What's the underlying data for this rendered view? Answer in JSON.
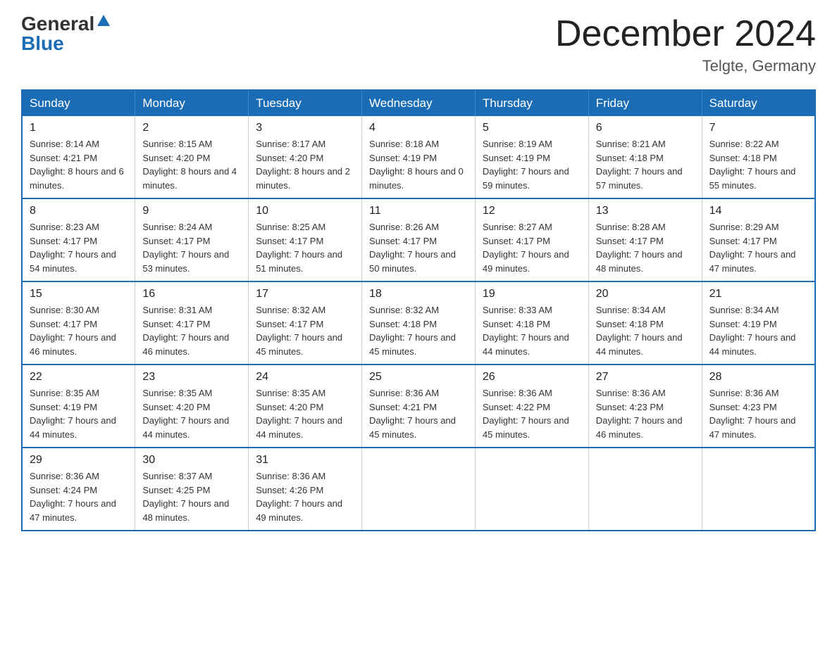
{
  "header": {
    "logo_general": "General",
    "logo_blue": "Blue",
    "month_title": "December 2024",
    "location": "Telgte, Germany"
  },
  "weekdays": [
    "Sunday",
    "Monday",
    "Tuesday",
    "Wednesday",
    "Thursday",
    "Friday",
    "Saturday"
  ],
  "weeks": [
    [
      {
        "day": "1",
        "sunrise": "8:14 AM",
        "sunset": "4:21 PM",
        "daylight": "8 hours and 6 minutes."
      },
      {
        "day": "2",
        "sunrise": "8:15 AM",
        "sunset": "4:20 PM",
        "daylight": "8 hours and 4 minutes."
      },
      {
        "day": "3",
        "sunrise": "8:17 AM",
        "sunset": "4:20 PM",
        "daylight": "8 hours and 2 minutes."
      },
      {
        "day": "4",
        "sunrise": "8:18 AM",
        "sunset": "4:19 PM",
        "daylight": "8 hours and 0 minutes."
      },
      {
        "day": "5",
        "sunrise": "8:19 AM",
        "sunset": "4:19 PM",
        "daylight": "7 hours and 59 minutes."
      },
      {
        "day": "6",
        "sunrise": "8:21 AM",
        "sunset": "4:18 PM",
        "daylight": "7 hours and 57 minutes."
      },
      {
        "day": "7",
        "sunrise": "8:22 AM",
        "sunset": "4:18 PM",
        "daylight": "7 hours and 55 minutes."
      }
    ],
    [
      {
        "day": "8",
        "sunrise": "8:23 AM",
        "sunset": "4:17 PM",
        "daylight": "7 hours and 54 minutes."
      },
      {
        "day": "9",
        "sunrise": "8:24 AM",
        "sunset": "4:17 PM",
        "daylight": "7 hours and 53 minutes."
      },
      {
        "day": "10",
        "sunrise": "8:25 AM",
        "sunset": "4:17 PM",
        "daylight": "7 hours and 51 minutes."
      },
      {
        "day": "11",
        "sunrise": "8:26 AM",
        "sunset": "4:17 PM",
        "daylight": "7 hours and 50 minutes."
      },
      {
        "day": "12",
        "sunrise": "8:27 AM",
        "sunset": "4:17 PM",
        "daylight": "7 hours and 49 minutes."
      },
      {
        "day": "13",
        "sunrise": "8:28 AM",
        "sunset": "4:17 PM",
        "daylight": "7 hours and 48 minutes."
      },
      {
        "day": "14",
        "sunrise": "8:29 AM",
        "sunset": "4:17 PM",
        "daylight": "7 hours and 47 minutes."
      }
    ],
    [
      {
        "day": "15",
        "sunrise": "8:30 AM",
        "sunset": "4:17 PM",
        "daylight": "7 hours and 46 minutes."
      },
      {
        "day": "16",
        "sunrise": "8:31 AM",
        "sunset": "4:17 PM",
        "daylight": "7 hours and 46 minutes."
      },
      {
        "day": "17",
        "sunrise": "8:32 AM",
        "sunset": "4:17 PM",
        "daylight": "7 hours and 45 minutes."
      },
      {
        "day": "18",
        "sunrise": "8:32 AM",
        "sunset": "4:18 PM",
        "daylight": "7 hours and 45 minutes."
      },
      {
        "day": "19",
        "sunrise": "8:33 AM",
        "sunset": "4:18 PM",
        "daylight": "7 hours and 44 minutes."
      },
      {
        "day": "20",
        "sunrise": "8:34 AM",
        "sunset": "4:18 PM",
        "daylight": "7 hours and 44 minutes."
      },
      {
        "day": "21",
        "sunrise": "8:34 AM",
        "sunset": "4:19 PM",
        "daylight": "7 hours and 44 minutes."
      }
    ],
    [
      {
        "day": "22",
        "sunrise": "8:35 AM",
        "sunset": "4:19 PM",
        "daylight": "7 hours and 44 minutes."
      },
      {
        "day": "23",
        "sunrise": "8:35 AM",
        "sunset": "4:20 PM",
        "daylight": "7 hours and 44 minutes."
      },
      {
        "day": "24",
        "sunrise": "8:35 AM",
        "sunset": "4:20 PM",
        "daylight": "7 hours and 44 minutes."
      },
      {
        "day": "25",
        "sunrise": "8:36 AM",
        "sunset": "4:21 PM",
        "daylight": "7 hours and 45 minutes."
      },
      {
        "day": "26",
        "sunrise": "8:36 AM",
        "sunset": "4:22 PM",
        "daylight": "7 hours and 45 minutes."
      },
      {
        "day": "27",
        "sunrise": "8:36 AM",
        "sunset": "4:23 PM",
        "daylight": "7 hours and 46 minutes."
      },
      {
        "day": "28",
        "sunrise": "8:36 AM",
        "sunset": "4:23 PM",
        "daylight": "7 hours and 47 minutes."
      }
    ],
    [
      {
        "day": "29",
        "sunrise": "8:36 AM",
        "sunset": "4:24 PM",
        "daylight": "7 hours and 47 minutes."
      },
      {
        "day": "30",
        "sunrise": "8:37 AM",
        "sunset": "4:25 PM",
        "daylight": "7 hours and 48 minutes."
      },
      {
        "day": "31",
        "sunrise": "8:36 AM",
        "sunset": "4:26 PM",
        "daylight": "7 hours and 49 minutes."
      },
      null,
      null,
      null,
      null
    ]
  ],
  "labels": {
    "sunrise": "Sunrise:",
    "sunset": "Sunset:",
    "daylight": "Daylight:"
  }
}
